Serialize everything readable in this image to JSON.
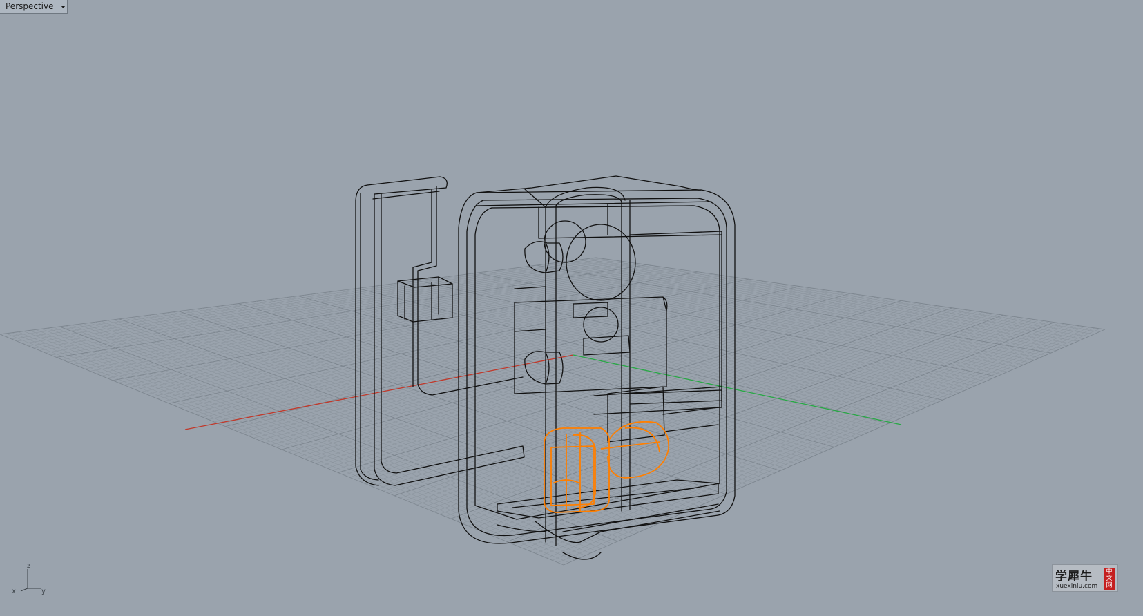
{
  "viewport": {
    "name": "Perspective",
    "dropdown_icon": "triangle-down-icon"
  },
  "axes_widget": {
    "z_label": "z",
    "y_label": "y",
    "x_label": "x"
  },
  "scene": {
    "grid_color": "#8a939c",
    "major_grid_color": "#7c858e",
    "x_axis_color": "#c0392b",
    "y_axis_color": "#27a844",
    "wireframe_color": "#111111",
    "selection_color": "#ff7f00"
  },
  "watermark": {
    "title": "学犀牛",
    "subtitle": "xuexiniu.com",
    "badge": [
      "中",
      "文",
      "网"
    ]
  }
}
